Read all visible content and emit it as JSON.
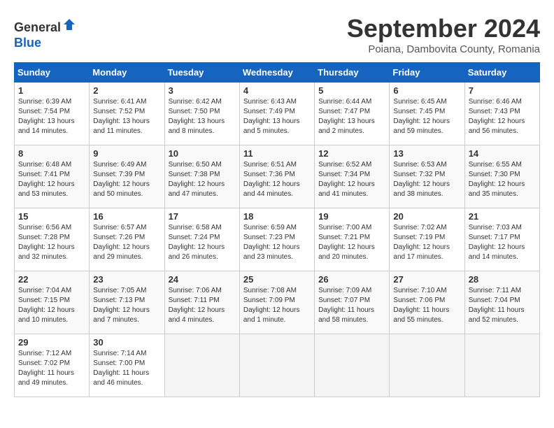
{
  "header": {
    "logo_line1": "General",
    "logo_line2": "Blue",
    "month": "September 2024",
    "location": "Poiana, Dambovita County, Romania"
  },
  "weekdays": [
    "Sunday",
    "Monday",
    "Tuesday",
    "Wednesday",
    "Thursday",
    "Friday",
    "Saturday"
  ],
  "weeks": [
    [
      {
        "day": "1",
        "info": "Sunrise: 6:39 AM\nSunset: 7:54 PM\nDaylight: 13 hours and 14 minutes."
      },
      {
        "day": "2",
        "info": "Sunrise: 6:41 AM\nSunset: 7:52 PM\nDaylight: 13 hours and 11 minutes."
      },
      {
        "day": "3",
        "info": "Sunrise: 6:42 AM\nSunset: 7:50 PM\nDaylight: 13 hours and 8 minutes."
      },
      {
        "day": "4",
        "info": "Sunrise: 6:43 AM\nSunset: 7:49 PM\nDaylight: 13 hours and 5 minutes."
      },
      {
        "day": "5",
        "info": "Sunrise: 6:44 AM\nSunset: 7:47 PM\nDaylight: 13 hours and 2 minutes."
      },
      {
        "day": "6",
        "info": "Sunrise: 6:45 AM\nSunset: 7:45 PM\nDaylight: 12 hours and 59 minutes."
      },
      {
        "day": "7",
        "info": "Sunrise: 6:46 AM\nSunset: 7:43 PM\nDaylight: 12 hours and 56 minutes."
      }
    ],
    [
      {
        "day": "8",
        "info": "Sunrise: 6:48 AM\nSunset: 7:41 PM\nDaylight: 12 hours and 53 minutes."
      },
      {
        "day": "9",
        "info": "Sunrise: 6:49 AM\nSunset: 7:39 PM\nDaylight: 12 hours and 50 minutes."
      },
      {
        "day": "10",
        "info": "Sunrise: 6:50 AM\nSunset: 7:38 PM\nDaylight: 12 hours and 47 minutes."
      },
      {
        "day": "11",
        "info": "Sunrise: 6:51 AM\nSunset: 7:36 PM\nDaylight: 12 hours and 44 minutes."
      },
      {
        "day": "12",
        "info": "Sunrise: 6:52 AM\nSunset: 7:34 PM\nDaylight: 12 hours and 41 minutes."
      },
      {
        "day": "13",
        "info": "Sunrise: 6:53 AM\nSunset: 7:32 PM\nDaylight: 12 hours and 38 minutes."
      },
      {
        "day": "14",
        "info": "Sunrise: 6:55 AM\nSunset: 7:30 PM\nDaylight: 12 hours and 35 minutes."
      }
    ],
    [
      {
        "day": "15",
        "info": "Sunrise: 6:56 AM\nSunset: 7:28 PM\nDaylight: 12 hours and 32 minutes."
      },
      {
        "day": "16",
        "info": "Sunrise: 6:57 AM\nSunset: 7:26 PM\nDaylight: 12 hours and 29 minutes."
      },
      {
        "day": "17",
        "info": "Sunrise: 6:58 AM\nSunset: 7:24 PM\nDaylight: 12 hours and 26 minutes."
      },
      {
        "day": "18",
        "info": "Sunrise: 6:59 AM\nSunset: 7:23 PM\nDaylight: 12 hours and 23 minutes."
      },
      {
        "day": "19",
        "info": "Sunrise: 7:00 AM\nSunset: 7:21 PM\nDaylight: 12 hours and 20 minutes."
      },
      {
        "day": "20",
        "info": "Sunrise: 7:02 AM\nSunset: 7:19 PM\nDaylight: 12 hours and 17 minutes."
      },
      {
        "day": "21",
        "info": "Sunrise: 7:03 AM\nSunset: 7:17 PM\nDaylight: 12 hours and 14 minutes."
      }
    ],
    [
      {
        "day": "22",
        "info": "Sunrise: 7:04 AM\nSunset: 7:15 PM\nDaylight: 12 hours and 10 minutes."
      },
      {
        "day": "23",
        "info": "Sunrise: 7:05 AM\nSunset: 7:13 PM\nDaylight: 12 hours and 7 minutes."
      },
      {
        "day": "24",
        "info": "Sunrise: 7:06 AM\nSunset: 7:11 PM\nDaylight: 12 hours and 4 minutes."
      },
      {
        "day": "25",
        "info": "Sunrise: 7:08 AM\nSunset: 7:09 PM\nDaylight: 12 hours and 1 minute."
      },
      {
        "day": "26",
        "info": "Sunrise: 7:09 AM\nSunset: 7:07 PM\nDaylight: 11 hours and 58 minutes."
      },
      {
        "day": "27",
        "info": "Sunrise: 7:10 AM\nSunset: 7:06 PM\nDaylight: 11 hours and 55 minutes."
      },
      {
        "day": "28",
        "info": "Sunrise: 7:11 AM\nSunset: 7:04 PM\nDaylight: 11 hours and 52 minutes."
      }
    ],
    [
      {
        "day": "29",
        "info": "Sunrise: 7:12 AM\nSunset: 7:02 PM\nDaylight: 11 hours and 49 minutes."
      },
      {
        "day": "30",
        "info": "Sunrise: 7:14 AM\nSunset: 7:00 PM\nDaylight: 11 hours and 46 minutes."
      },
      {
        "day": "",
        "info": ""
      },
      {
        "day": "",
        "info": ""
      },
      {
        "day": "",
        "info": ""
      },
      {
        "day": "",
        "info": ""
      },
      {
        "day": "",
        "info": ""
      }
    ]
  ]
}
